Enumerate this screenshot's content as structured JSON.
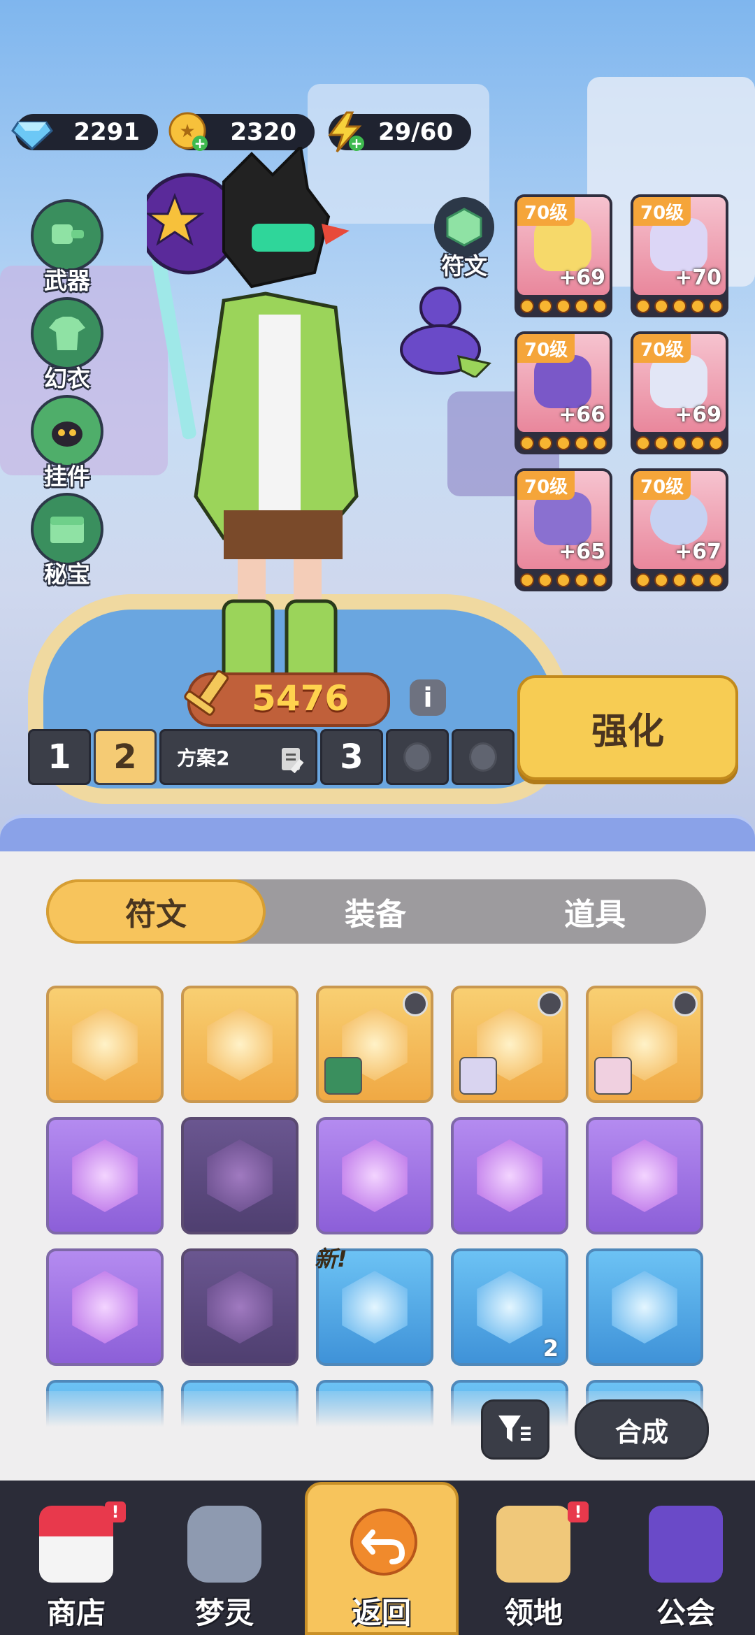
{
  "resources": {
    "diamonds": "2291",
    "coins": "2320",
    "energy": "29/60"
  },
  "side_menu": [
    {
      "label": "武器",
      "icon": "weapon-icon"
    },
    {
      "label": "幻衣",
      "icon": "outfit-icon"
    },
    {
      "label": "挂件",
      "icon": "pendant-icon"
    },
    {
      "label": "秘宝",
      "icon": "treasure-icon"
    }
  ],
  "rune_label": "符文",
  "equipment": [
    {
      "level": "70级",
      "plus": "+69"
    },
    {
      "level": "70级",
      "plus": "+70"
    },
    {
      "level": "70级",
      "plus": "+66"
    },
    {
      "level": "70级",
      "plus": "+69"
    },
    {
      "level": "70级",
      "plus": "+65"
    },
    {
      "level": "70级",
      "plus": "+67"
    }
  ],
  "power": "5476",
  "presets": {
    "slot1": "1",
    "slot2": "2",
    "plan_name": "方案2",
    "slot3": "3"
  },
  "enhance_label": "强化",
  "tabs": [
    "符文",
    "装备",
    "道具"
  ],
  "inventory": {
    "new_tag": "新!",
    "count_label": "2"
  },
  "actions": {
    "compose_label": "合成"
  },
  "nav": {
    "shop": "商店",
    "dream": "梦灵",
    "back": "返回",
    "territory": "领地",
    "guild": "公会",
    "badge": "!"
  },
  "colors": {
    "accent_gold": "#f7c45c",
    "power_yellow": "#ffd34e",
    "dark_ui": "#2b2c38"
  }
}
